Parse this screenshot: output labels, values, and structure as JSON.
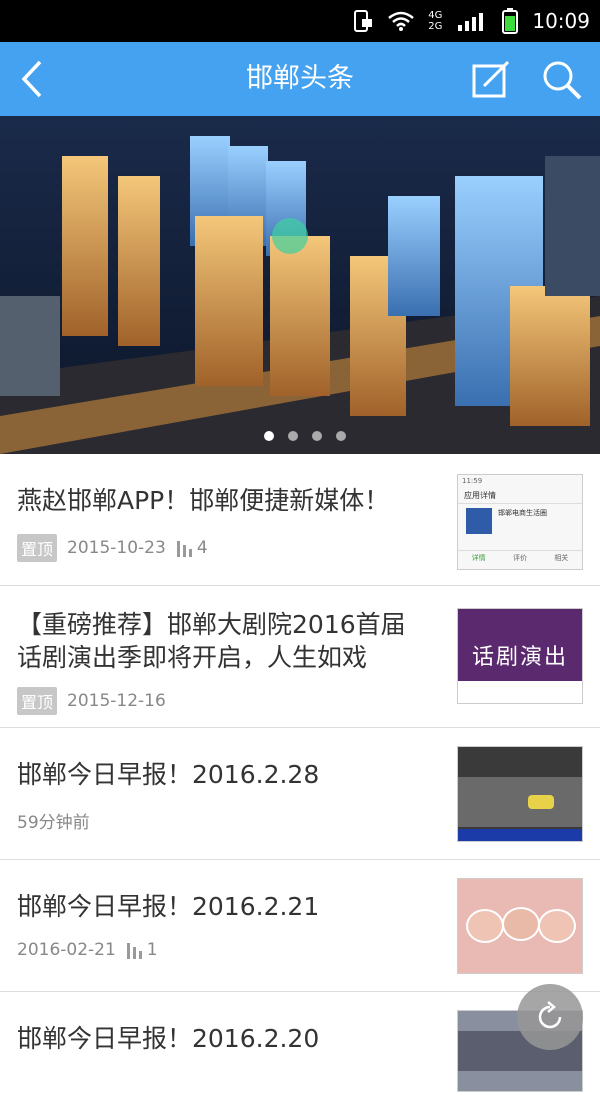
{
  "status_bar": {
    "time": "10:09",
    "net_4g": "4G",
    "net_2g": "2G"
  },
  "header": {
    "title": "邯郸头条"
  },
  "banner": {
    "page_count": 4,
    "active_index": 0
  },
  "news": [
    {
      "title": "燕赵邯郸APP！邯郸便捷新媒体！",
      "badge": "置顶",
      "date": "2015-10-23",
      "views": "4"
    },
    {
      "title": "【重磅推荐】邯郸大剧院2016首届话剧演出季即将开启，人生如戏",
      "badge": "置顶",
      "date": "2015-12-16"
    },
    {
      "title": "邯郸今日早报！2016.2.28",
      "time": "59分钟前"
    },
    {
      "title": "邯郸今日早报！2016.2.21",
      "date": "2016-02-21",
      "views": "1"
    },
    {
      "title": "邯郸今日早报！2016.2.20"
    }
  ],
  "thumbs": {
    "app": {
      "status_time": "11:59",
      "heading": "应用详情",
      "app_name": "邯郸电商生活圈",
      "tab1": "详情",
      "tab2": "评价",
      "tab3": "相关"
    },
    "drama": {
      "text": "话剧演出"
    }
  },
  "icons": {
    "back": "back-arrow-icon",
    "edit": "edit-icon",
    "search": "search-icon",
    "views": "views-bar-icon",
    "refresh": "refresh-icon"
  }
}
